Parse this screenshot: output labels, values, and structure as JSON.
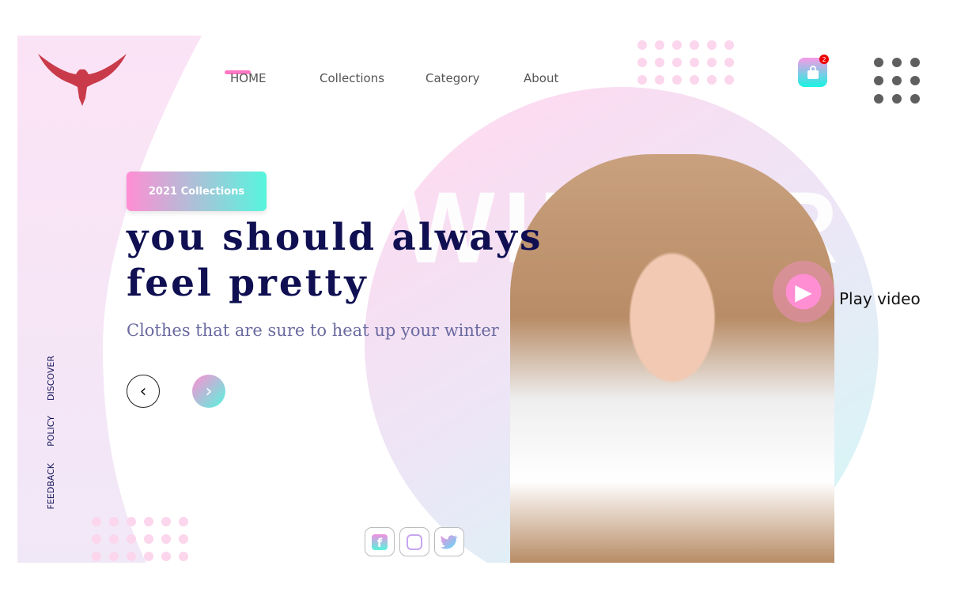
{
  "nav": {
    "items": [
      {
        "label": "HOME",
        "active": true
      },
      {
        "label": "Collections"
      },
      {
        "label": "Category"
      },
      {
        "label": "About"
      }
    ]
  },
  "cart": {
    "count": "2",
    "icon": "shopping-bag-icon"
  },
  "menu_icon": "grid-dots-icon",
  "hero": {
    "badge": "2021 Collections",
    "headline_line1": "you should always",
    "headline_line2": "feel pretty",
    "subtitle": "Clothes that are sure to heat up your winter",
    "background_word": "WINTER",
    "play_label": "Play video"
  },
  "side_links": [
    "DISCOVER",
    "POLICY",
    "FEEDBACK"
  ],
  "social": [
    "facebook-icon",
    "instagram-icon",
    "twitter-icon"
  ],
  "colors": {
    "accent_pink": "#ff8ed3",
    "accent_cyan": "#56f5dd",
    "headline": "#0f0f52",
    "logo": "#c93a4a"
  }
}
